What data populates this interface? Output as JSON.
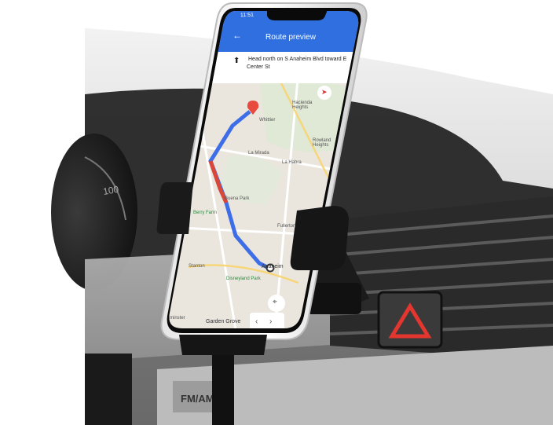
{
  "status_bar": {
    "time": "11:51"
  },
  "nav": {
    "title": "Route preview",
    "instruction": [
      "Head north on S Anaheim Blvd toward E",
      "Center St"
    ]
  },
  "map_labels": {
    "la_mirada": "La Mirada",
    "la_habra": "La Habra",
    "buena_park": "Buena Park",
    "fullerton": "Fullerton",
    "anaheim": "Anaheim",
    "disneyland_park": "Disneyland Park",
    "stanton": "Stanton",
    "garden_grove": "Garden Grove",
    "westminster": "minster",
    "hacienda_heights": "Hacienda Heights",
    "rowland_heights": "Rowland Heights",
    "whittier": "Whittier",
    "knotts_berry_farm": "Berry Farm"
  },
  "car": {
    "radio_label": "FM/AM",
    "hazard_icon": "hazard-triangle-icon"
  },
  "colors": {
    "route_blue": "#3d6ee8",
    "route_traffic": "#d9473a",
    "header_blue": "#2f6fe0",
    "hazard_red": "#e2362f"
  },
  "icons": [
    "back-arrow-icon",
    "north-arrow-icon",
    "compass-icon",
    "locate-me-icon",
    "chevron-left-icon",
    "chevron-right-icon",
    "destination-pin-icon"
  ]
}
